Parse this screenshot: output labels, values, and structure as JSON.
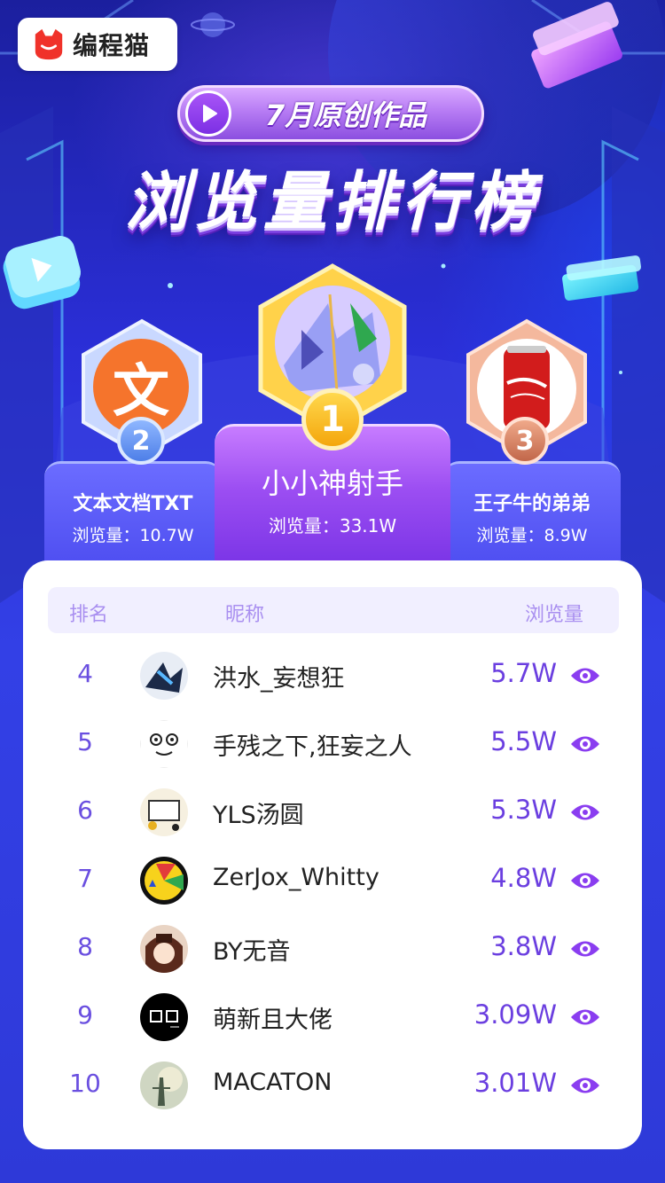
{
  "brand": {
    "name": "编程猫",
    "logo_icon": "cat-logo-icon"
  },
  "header": {
    "subtitle": "7月原创作品",
    "title": "浏览量排行榜"
  },
  "podium": {
    "first": {
      "rank": "1",
      "name": "小小神射手",
      "views": "浏览量：33.1W"
    },
    "second": {
      "rank": "2",
      "name": "文本文档TXT",
      "views": "浏览量：10.7W",
      "avatar_text": "文"
    },
    "third": {
      "rank": "3",
      "name": "王子牛的弟弟",
      "views": "浏览量：8.9W"
    }
  },
  "table": {
    "headers": {
      "rank": "排名",
      "name": "昵称",
      "views": "浏览量"
    },
    "rows": [
      {
        "rank": "4",
        "name": "洪水_妄想狂",
        "views": "5.7W"
      },
      {
        "rank": "5",
        "name": "手残之下,狂妄之人",
        "views": "5.5W"
      },
      {
        "rank": "6",
        "name": "YLS汤圆",
        "views": "5.3W"
      },
      {
        "rank": "7",
        "name": "ZerJox_Whitty",
        "views": "4.8W"
      },
      {
        "rank": "8",
        "name": "BY无音",
        "views": "3.8W"
      },
      {
        "rank": "9",
        "name": "萌新且大佬",
        "views": "3.09W"
      },
      {
        "rank": "10",
        "name": "MACATON",
        "views": "3.01W"
      }
    ]
  },
  "colors": {
    "accent": "#6b3fe0",
    "background": "#2b2fd8",
    "brand_red": "#f0322a"
  }
}
